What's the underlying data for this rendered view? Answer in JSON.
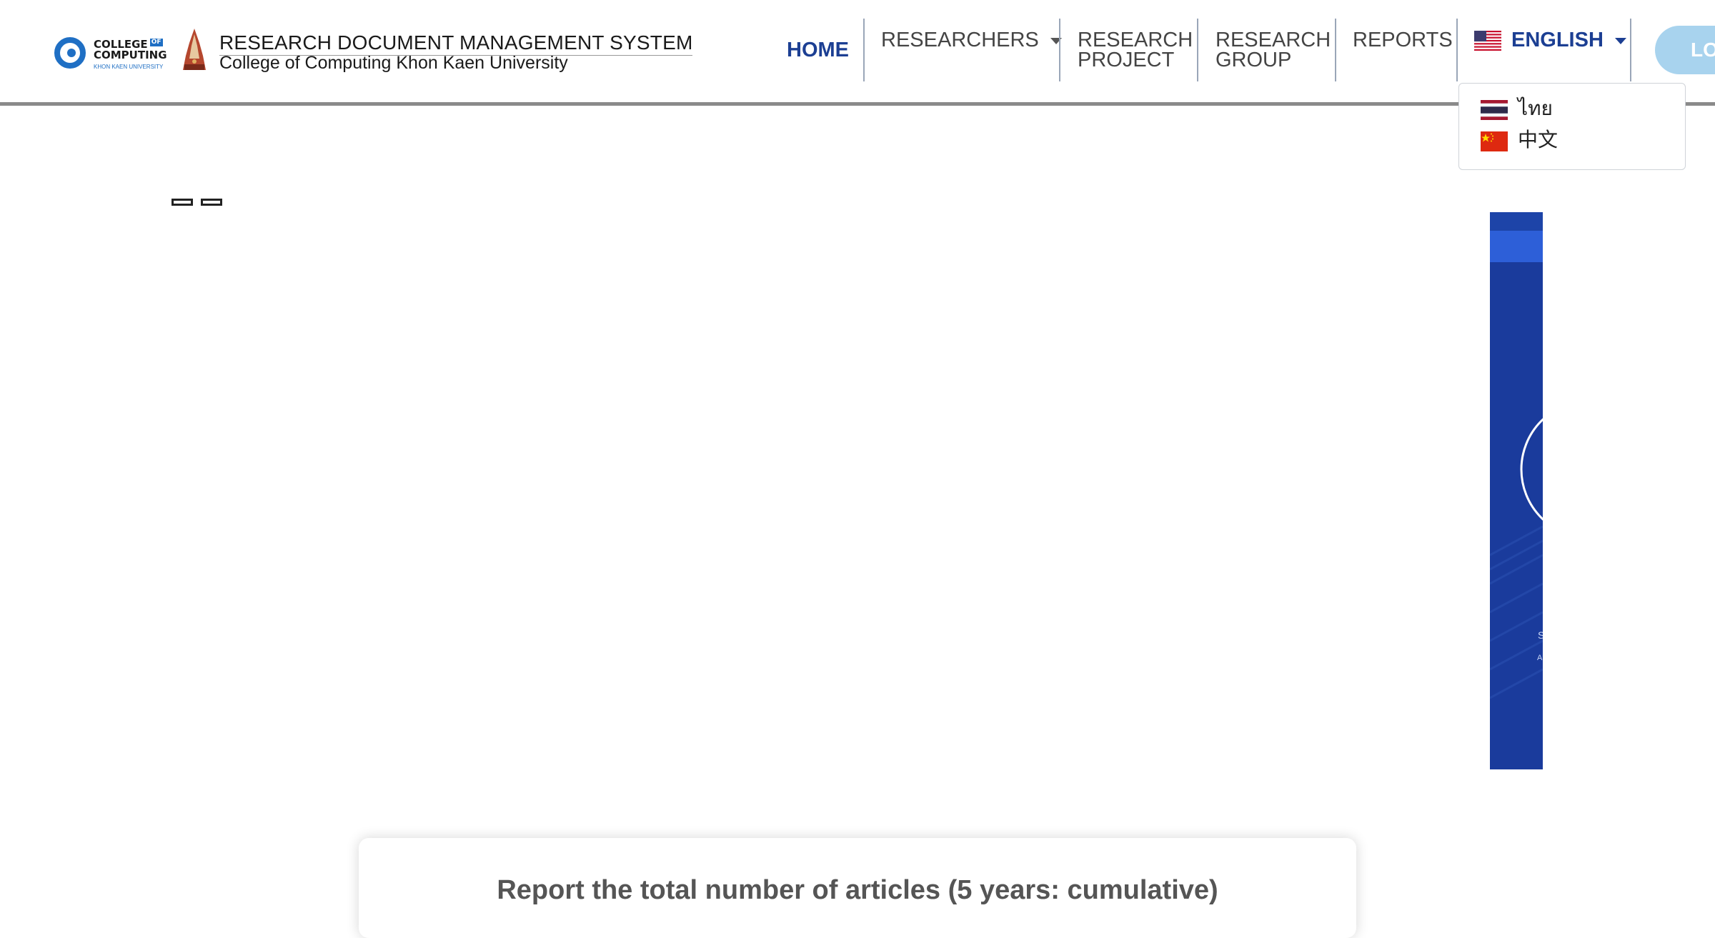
{
  "brand": {
    "logo_line1": "COLLEGE",
    "logo_of": "OF",
    "logo_line2": "COMPUTING",
    "logo_line3": "KHON KAEN UNIVERSITY",
    "title": "RESEARCH DOCUMENT MANAGEMENT SYSTEM",
    "subtitle": "College of Computing Khon Kaen University"
  },
  "nav": {
    "home": "HOME",
    "researchers": "RESEARCHERS",
    "research_project_1": "RESEARCH",
    "research_project_2": "PROJECT",
    "research_group_1": "RESEARCH",
    "research_group_2": "GROUP",
    "reports": "REPORTS",
    "language": "ENGLISH",
    "login": "LO"
  },
  "language_menu": {
    "options": [
      {
        "label": "ไทย",
        "flag": "thailand-flag-icon"
      },
      {
        "label": "中文",
        "flag": "china-flag-icon"
      }
    ]
  },
  "banner": {
    "text1": "S",
    "text2": "A"
  },
  "report": {
    "title": "Report the total number of articles (5 years: cumulative)"
  },
  "colors": {
    "nav_active": "#1c3f93",
    "banner_blue": "#1a3b9c",
    "login_button": "#a8d3ee"
  }
}
